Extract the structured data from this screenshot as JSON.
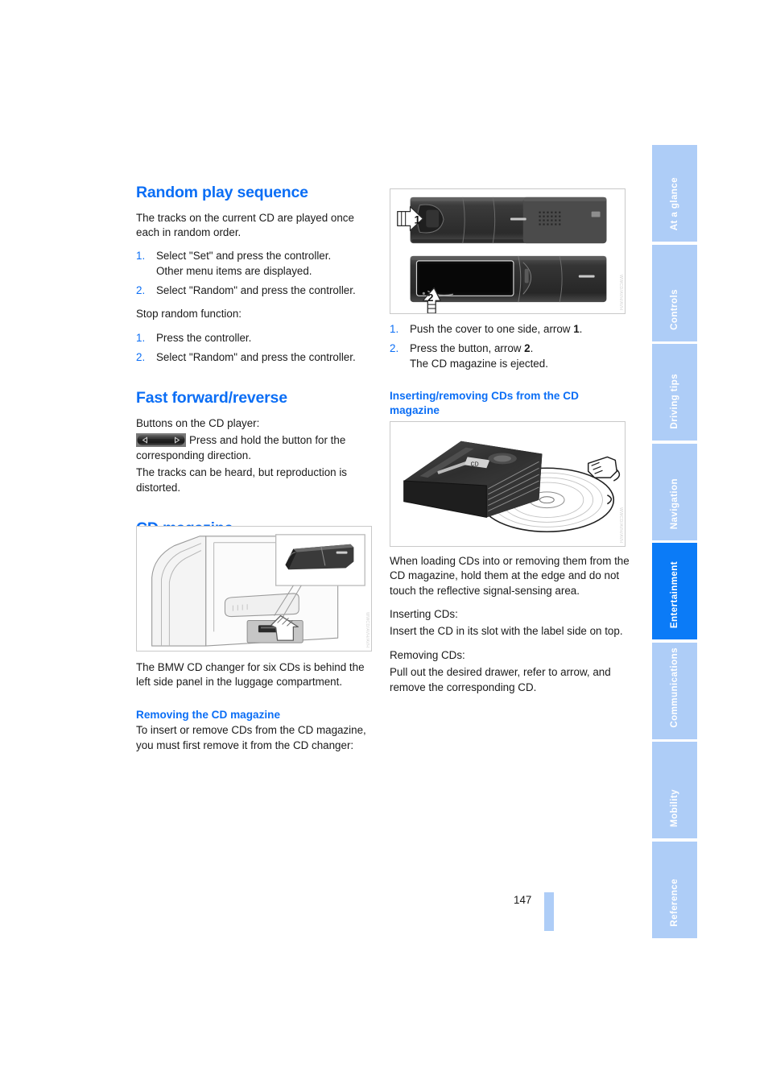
{
  "page": {
    "number": "147",
    "accent_blue": "#0b6ef5",
    "tab_blue_active": "#0b7bf7",
    "tab_blue_inactive": "#aecdf7"
  },
  "left_column": {
    "section1": {
      "title": "Random play sequence",
      "intro": "The tracks on the current CD are played once each in random order.",
      "steps": [
        {
          "num": "1.",
          "text": "Select \"Set\" and press the controller.",
          "sub": "Other menu items are displayed."
        },
        {
          "num": "2.",
          "text": "Select \"Random\" and press the controller.",
          "sub": ""
        }
      ],
      "stop_label": "Stop random function:",
      "stop_steps": [
        {
          "num": "1.",
          "text": "Press the controller.",
          "sub": ""
        },
        {
          "num": "2.",
          "text": "Select \"Random\" and press the controller.",
          "sub": ""
        }
      ]
    },
    "section2": {
      "title": "Fast forward/reverse",
      "intro": "Buttons on the CD player:",
      "icon_name": "fast-forward-reverse-rocker-button",
      "icon_text": "Press and hold the button for the corresponding direction.",
      "note": "The tracks can be heard, but reproduction is distorted."
    },
    "section3": {
      "title": "CD magazine",
      "figure_caption_code": "WWCD/AVH/AVH",
      "body": "The BMW CD changer for six CDs is behind the left side panel in the luggage compartment.",
      "subsection": {
        "title": "Removing the CD magazine",
        "body": "To insert or remove CDs from the CD magazine, you must first remove it from the CD changer:"
      }
    }
  },
  "right_column": {
    "figure_changer_code": "WWCD/AVH/AVH",
    "steps": [
      {
        "num": "1.",
        "text": "Push the cover to one side, arrow ",
        "bold": "1",
        "tail": ".",
        "sub": ""
      },
      {
        "num": "2.",
        "text": "Press the button, arrow ",
        "bold": "2",
        "tail": ".",
        "sub": "The CD magazine is ejected."
      }
    ],
    "section": {
      "title": "Inserting/removing CDs from the CD magazine",
      "figure_code": "WWCD/AVH/AVH",
      "body": "When loading CDs into or removing them from the CD magazine, hold them at the edge and do not touch the reflective signal-sensing area.",
      "inserting_label": "Inserting CDs:",
      "inserting_body": "Insert the CD in its slot with the label side on top.",
      "removing_label": "Removing CDs:",
      "removing_body": "Pull out the desired drawer, refer to arrow, and remove the corresponding CD."
    }
  },
  "tabs": [
    {
      "label": "At a glance",
      "active": false
    },
    {
      "label": "Controls",
      "active": false
    },
    {
      "label": "Driving tips",
      "active": false
    },
    {
      "label": "Navigation",
      "active": false
    },
    {
      "label": "Entertainment",
      "active": true
    },
    {
      "label": "Communications",
      "active": false
    },
    {
      "label": "Mobility",
      "active": false
    },
    {
      "label": "Reference",
      "active": false
    }
  ]
}
